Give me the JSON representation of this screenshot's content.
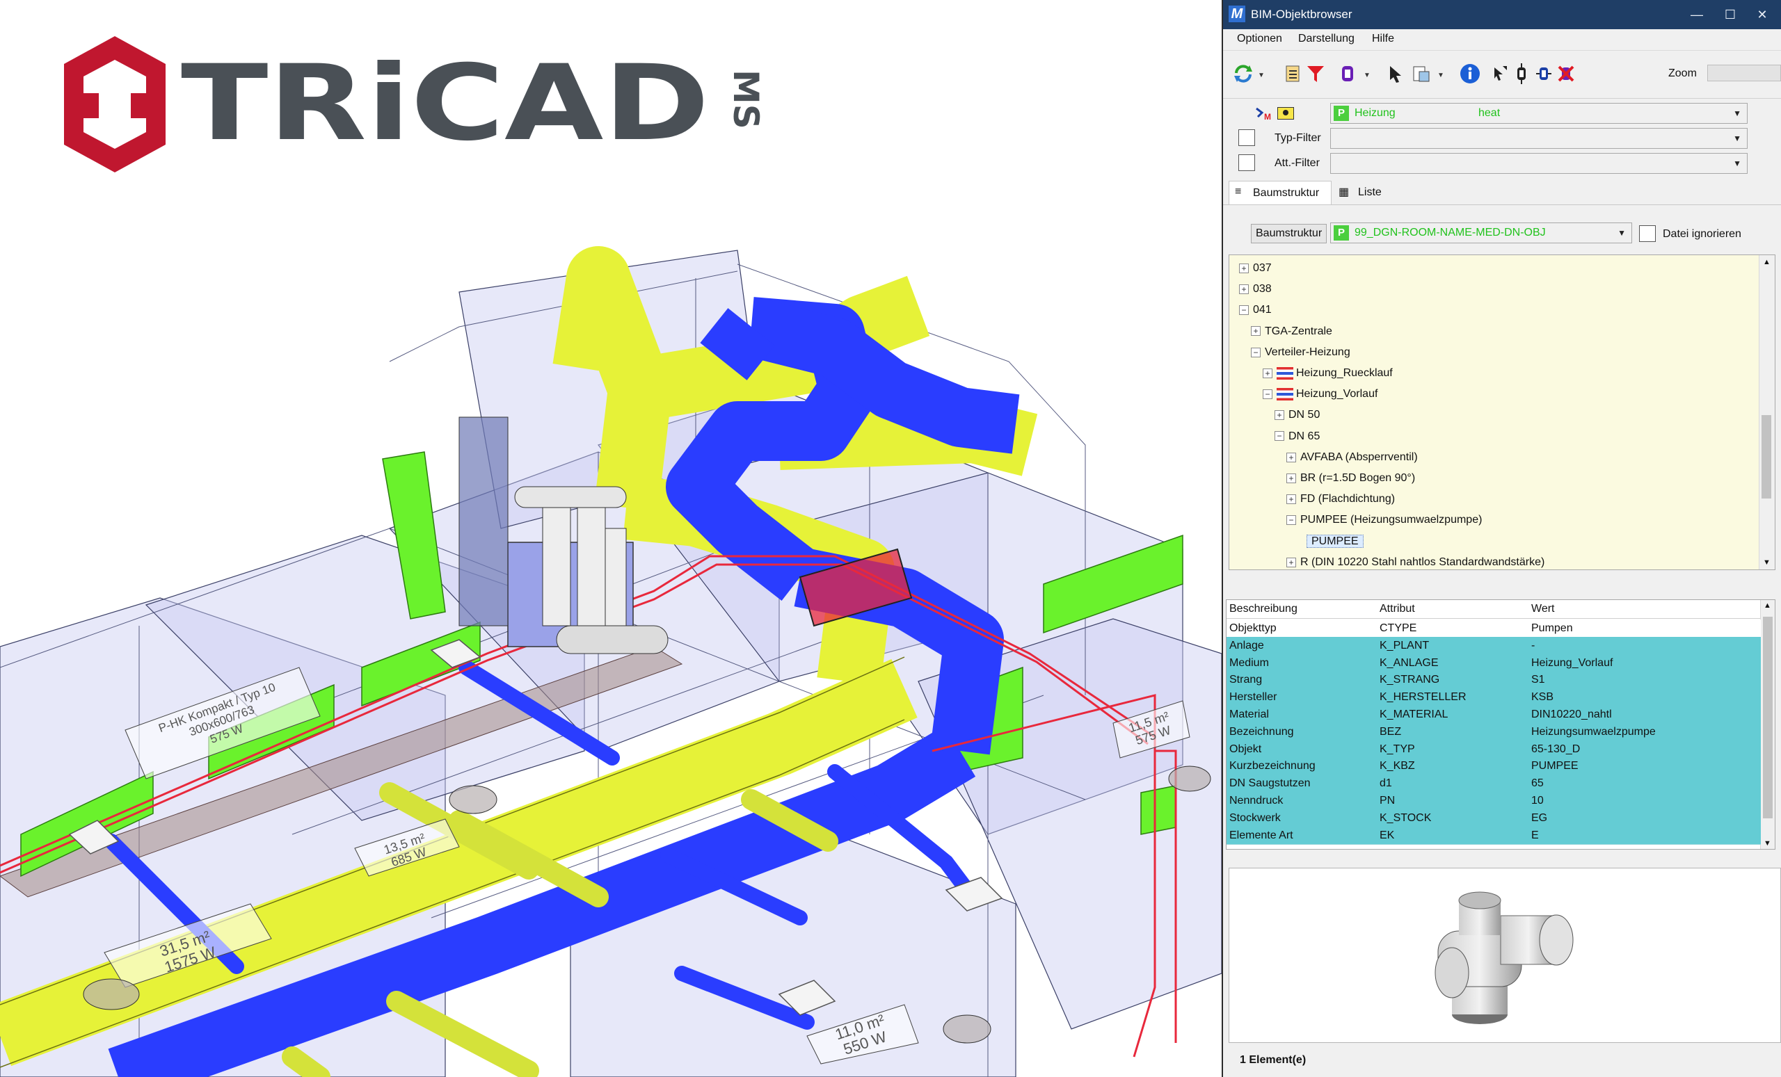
{
  "window": {
    "title": "BIM-Objektbrowser",
    "icon": "microstation-logo-icon",
    "controls": [
      "—",
      "☐",
      "✕"
    ]
  },
  "logo": {
    "text": "TRiCAD",
    "suffix": "MS"
  },
  "menu": [
    "Optionen",
    "Darstellung",
    "Hilfe"
  ],
  "toolbar": {
    "icons": [
      "refresh-icon",
      "clipboard-list-icon",
      "filter-icon",
      "object-select-icon",
      "pointer-icon",
      "export-icon",
      "info-icon",
      "pick-icon",
      "isolate-icon",
      "fit-icon",
      "clear-icon"
    ],
    "zoom_label": "Zoom",
    "zoom_value": ""
  },
  "filters": {
    "main_name": "Heizung",
    "main_value": "heat",
    "type_filter_label": "Typ-Filter",
    "att_filter_label": "Att.-Filter"
  },
  "tabs": {
    "tree_label": "Baumstruktur",
    "list_label": "Liste"
  },
  "structure": {
    "button_label": "Baumstruktur",
    "selected": "99_DGN-ROOM-NAME-MED-DN-OBJ",
    "ignore_file_label": "Datei ignorieren"
  },
  "tree": [
    {
      "label": "037",
      "level": 0,
      "toggle": "+"
    },
    {
      "label": "038",
      "level": 0,
      "toggle": "+"
    },
    {
      "label": "041",
      "level": 0,
      "toggle": "−"
    },
    {
      "label": "TGA-Zentrale",
      "level": 1,
      "toggle": "+"
    },
    {
      "label": "Verteiler-Heizung",
      "level": 1,
      "toggle": "−"
    },
    {
      "label": "Heizung_Ruecklauf",
      "level": 2,
      "toggle": "+",
      "flag": true
    },
    {
      "label": "Heizung_Vorlauf",
      "level": 2,
      "toggle": "−",
      "flag": true
    },
    {
      "label": "DN 50",
      "level": 3,
      "toggle": "+"
    },
    {
      "label": "DN 65",
      "level": 3,
      "toggle": "−"
    },
    {
      "label": "AVFABA (Absperrventil)",
      "level": 4,
      "toggle": "+"
    },
    {
      "label": "BR (r=1.5D Bogen 90°)",
      "level": 4,
      "toggle": "+"
    },
    {
      "label": "FD (Flachdichtung)",
      "level": 4,
      "toggle": "+"
    },
    {
      "label": "PUMPEE (Heizungsumwaelzpumpe)",
      "level": 4,
      "toggle": "−"
    },
    {
      "label": "PUMPEE",
      "level": 5,
      "toggle": "",
      "selected": true
    },
    {
      "label": "R (DIN 10220 Stahl nahtlos Standardwandstärke)",
      "level": 4,
      "toggle": "+"
    }
  ],
  "grid": {
    "headers": [
      "Beschreibung",
      "Attribut",
      "Wert"
    ],
    "rows": [
      [
        "Objekttyp",
        "CTYPE",
        "Pumpen"
      ],
      [
        "Anlage",
        "K_PLANT",
        "-"
      ],
      [
        "Medium",
        "K_ANLAGE",
        "Heizung_Vorlauf"
      ],
      [
        "Strang",
        "K_STRANG",
        "S1"
      ],
      [
        "Hersteller",
        "K_HERSTELLER",
        "KSB"
      ],
      [
        "Material",
        "K_MATERIAL",
        "DIN10220_nahtl"
      ],
      [
        "Bezeichnung",
        "BEZ",
        "Heizungsumwaelzpumpe"
      ],
      [
        "Objekt",
        "K_TYP",
        "65-130_D"
      ],
      [
        "Kurzbezeichnung",
        "K_KBZ",
        "PUMPEE"
      ],
      [
        "DN Saugstutzen",
        "d1",
        "65"
      ],
      [
        "Nenndruck",
        "PN",
        "10"
      ],
      [
        "Stockwerk",
        "K_STOCK",
        "EG"
      ],
      [
        "Elemente Art",
        "EK",
        "E"
      ]
    ]
  },
  "status": "1 Element(e)",
  "colors": {
    "titlebar": "#1f3e66",
    "tree_bg": "#fbfae0",
    "grid_row": "#64ccd4",
    "duct_blue": "#2a3dff",
    "duct_yellow": "#e8f53a",
    "pipe_red": "#e8283c",
    "logo_red": "#c0172f",
    "logo_gray": "#4a5056"
  },
  "viewport": {
    "room_labels": [
      {
        "lines": [
          "31,5 m²",
          "1575 W"
        ]
      },
      {
        "lines": [
          "13,5 m²",
          "685 W"
        ]
      },
      {
        "lines": [
          "11,0 m²",
          "550 W"
        ]
      },
      {
        "lines": [
          "11,5 m²",
          "575 W"
        ]
      },
      {
        "lines": [
          "P-HK Kompakt / Typ 10",
          "300x600/763",
          "575 W"
        ]
      }
    ]
  }
}
